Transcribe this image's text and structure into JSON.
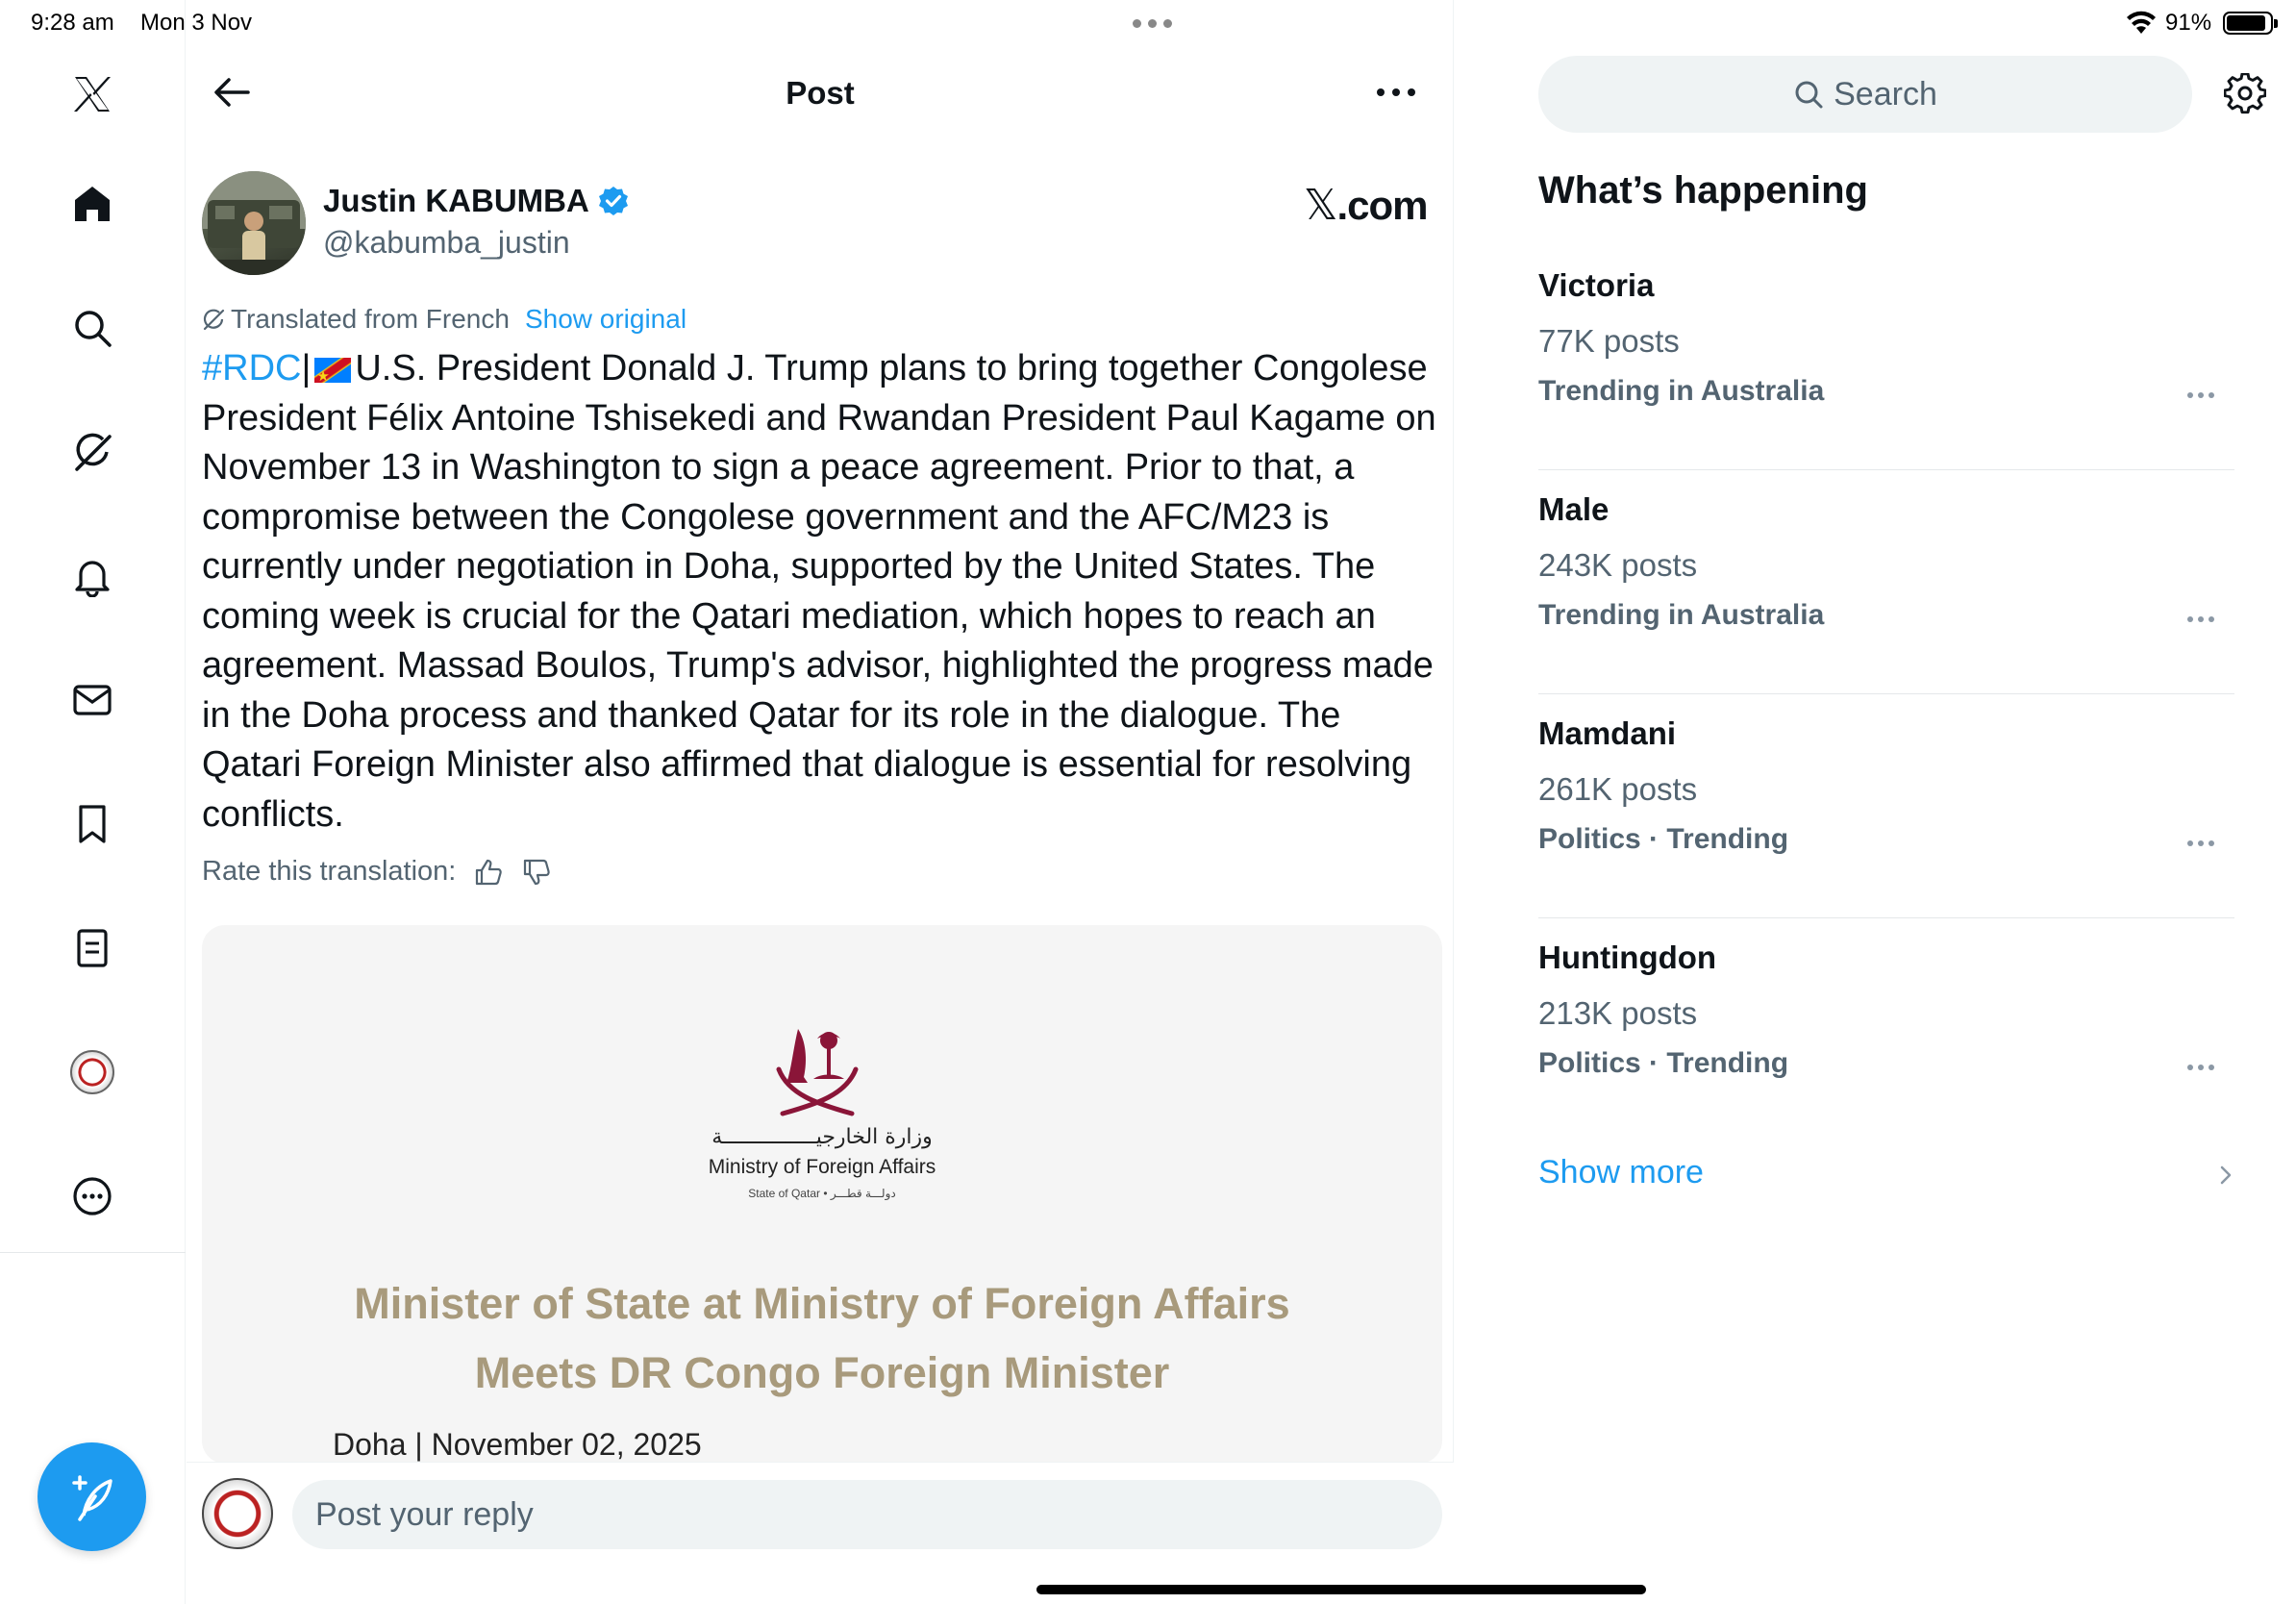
{
  "status_bar": {
    "time": "9:28 am",
    "date": "Mon 3 Nov",
    "battery": "91%",
    "battery_level": 0.91
  },
  "nav": {
    "items": [
      "x-logo",
      "home-icon",
      "search-icon",
      "grok-icon",
      "bell-icon",
      "mail-icon",
      "bookmark-icon",
      "lists-icon",
      "profile-avatar",
      "more-circle-icon"
    ],
    "compose_icon": "feather-plus-icon"
  },
  "header": {
    "title": "Post"
  },
  "post": {
    "author_name": "Justin KABUMBA",
    "author_handle": "@kabumba_justin",
    "verified": true,
    "source_label": ".com",
    "source_logo": "𝕏",
    "translated_label": "Translated from French",
    "show_original": "Show original",
    "hashtag": "#RDC",
    "separator": "|",
    "body": "U.S. President Donald J. Trump plans to bring together Congolese President Félix Antoine Tshisekedi and Rwandan President Paul Kagame on November 13 in Washington to sign a peace agreement. Prior to that, a compromise between the Congolese government and the AFC/M23 is currently under negotiation in Doha, supported by the United States. The coming week is crucial for the Qatari mediation, which hopes to reach an agreement. Massad Boulos, Trump's advisor, highlighted the progress made in the Doha process and thanked Qatar for its role in the dialogue. The Qatari Foreign Minister also affirmed that dialogue is essential for resolving conflicts.",
    "rate_label": "Rate this translation:",
    "media": {
      "arabic_name": "وزارة الخارجيـــــــــــــــة",
      "ministry_en": "Ministry of Foreign Affairs",
      "state_line": "State of Qatar • دولـــة قطـــر",
      "headline_line1": "Minister of State at Ministry of Foreign Affairs",
      "headline_line2": "Meets DR Congo Foreign Minister",
      "dateline": "Doha | November 02, 2025"
    }
  },
  "reply": {
    "placeholder": "Post your reply"
  },
  "sidebar": {
    "search_placeholder": "Search",
    "section_title": "What’s happening",
    "trends": [
      {
        "name": "Victoria",
        "posts": "77K posts",
        "context": "Trending in Australia"
      },
      {
        "name": "Male",
        "posts": "243K posts",
        "context": "Trending in Australia"
      },
      {
        "name": "Mamdani",
        "posts": "261K posts",
        "context": "Politics · Trending"
      },
      {
        "name": "Huntingdon",
        "posts": "213K posts",
        "context": "Politics · Trending"
      }
    ],
    "show_more": "Show more"
  },
  "colors": {
    "accent": "#1d9bf0",
    "secondary_text": "#536471",
    "headline_gold": "#a89a7c"
  }
}
